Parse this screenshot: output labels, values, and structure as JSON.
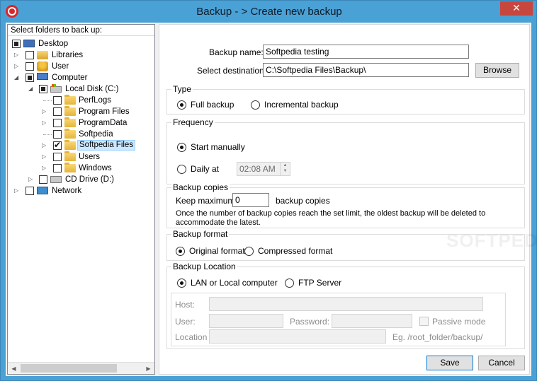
{
  "window": {
    "title": "Backup - > Create new backup",
    "close_glyph": "✕"
  },
  "tree": {
    "header": "Select folders to back up:",
    "items": [
      {
        "label": "Desktop",
        "icon": "desktop-icon",
        "state": "partial",
        "expander": "",
        "level": 0
      },
      {
        "label": "Libraries",
        "icon": "libraries-icon",
        "state": "unchecked",
        "expander": "▷",
        "level": 1
      },
      {
        "label": "User",
        "icon": "user-icon",
        "state": "unchecked",
        "expander": "▷",
        "level": 1
      },
      {
        "label": "Computer",
        "icon": "computer-icon",
        "state": "partial",
        "expander": "◢",
        "level": 1
      },
      {
        "label": "Local Disk (C:)",
        "icon": "disk-icon",
        "state": "partial",
        "expander": "◢",
        "level": 2
      },
      {
        "label": "PerfLogs",
        "icon": "folder-icon",
        "state": "unchecked",
        "expander": "",
        "level": 3
      },
      {
        "label": "Program Files",
        "icon": "folder-icon",
        "state": "unchecked",
        "expander": "▷",
        "level": 3
      },
      {
        "label": "ProgramData",
        "icon": "folder-icon",
        "state": "unchecked",
        "expander": "▷",
        "level": 3
      },
      {
        "label": "Softpedia",
        "icon": "folder-icon",
        "state": "unchecked",
        "expander": "",
        "level": 3
      },
      {
        "label": "Softpedia Files",
        "icon": "folder-icon",
        "state": "checked",
        "expander": "▷",
        "level": 3,
        "selected": true
      },
      {
        "label": "Users",
        "icon": "folder-icon",
        "state": "unchecked",
        "expander": "▷",
        "level": 3
      },
      {
        "label": "Windows",
        "icon": "folder-icon",
        "state": "unchecked",
        "expander": "▷",
        "level": 3
      },
      {
        "label": "CD Drive (D:)",
        "icon": "cd-drive-icon",
        "state": "unchecked",
        "expander": "▷",
        "level": 2
      },
      {
        "label": "Network",
        "icon": "network-icon",
        "state": "unchecked",
        "expander": "▷",
        "level": 1
      }
    ]
  },
  "form": {
    "backup_name_label": "Backup name:",
    "backup_name_value": "Softpedia testing",
    "destination_label": "Select destination:",
    "destination_value": "C:\\Softpedia Files\\Backup\\",
    "browse_label": "Browse"
  },
  "type_group": {
    "title": "Type",
    "full_label": "Full backup",
    "incremental_label": "Incremental backup",
    "selected": "full"
  },
  "frequency_group": {
    "title": "Frequency",
    "manual_label": "Start manually",
    "daily_label": "Daily at",
    "time_value": "02:08 AM",
    "selected": "manual"
  },
  "copies_group": {
    "title": "Backup copies",
    "keep_label": "Keep maximum",
    "keep_value": "0",
    "suffix_label": "backup copies",
    "note_line1": "Once the number of backup copies reach the set limit, the oldest backup will be deleted to",
    "note_line2": "accommodate the latest."
  },
  "format_group": {
    "title": "Backup format",
    "original_label": "Original format",
    "compressed_label": "Compressed format",
    "selected": "original"
  },
  "location_group": {
    "title": "Backup Location",
    "lan_label": "LAN or Local computer",
    "ftp_label": "FTP Server",
    "selected": "lan",
    "host_label": "Host:",
    "user_label": "User:",
    "password_label": "Password:",
    "passive_label": "Passive mode",
    "location_label": "Location",
    "example_text": "Eg. /root_folder/backup/"
  },
  "footer": {
    "save_label": "Save",
    "cancel_label": "Cancel"
  },
  "watermark": "SOFTPEDIA",
  "colors": {
    "titlebar": "#4aa1d5",
    "close_button": "#c7463d",
    "selection": "#cce8ff",
    "default_button_border": "#0078d7"
  }
}
